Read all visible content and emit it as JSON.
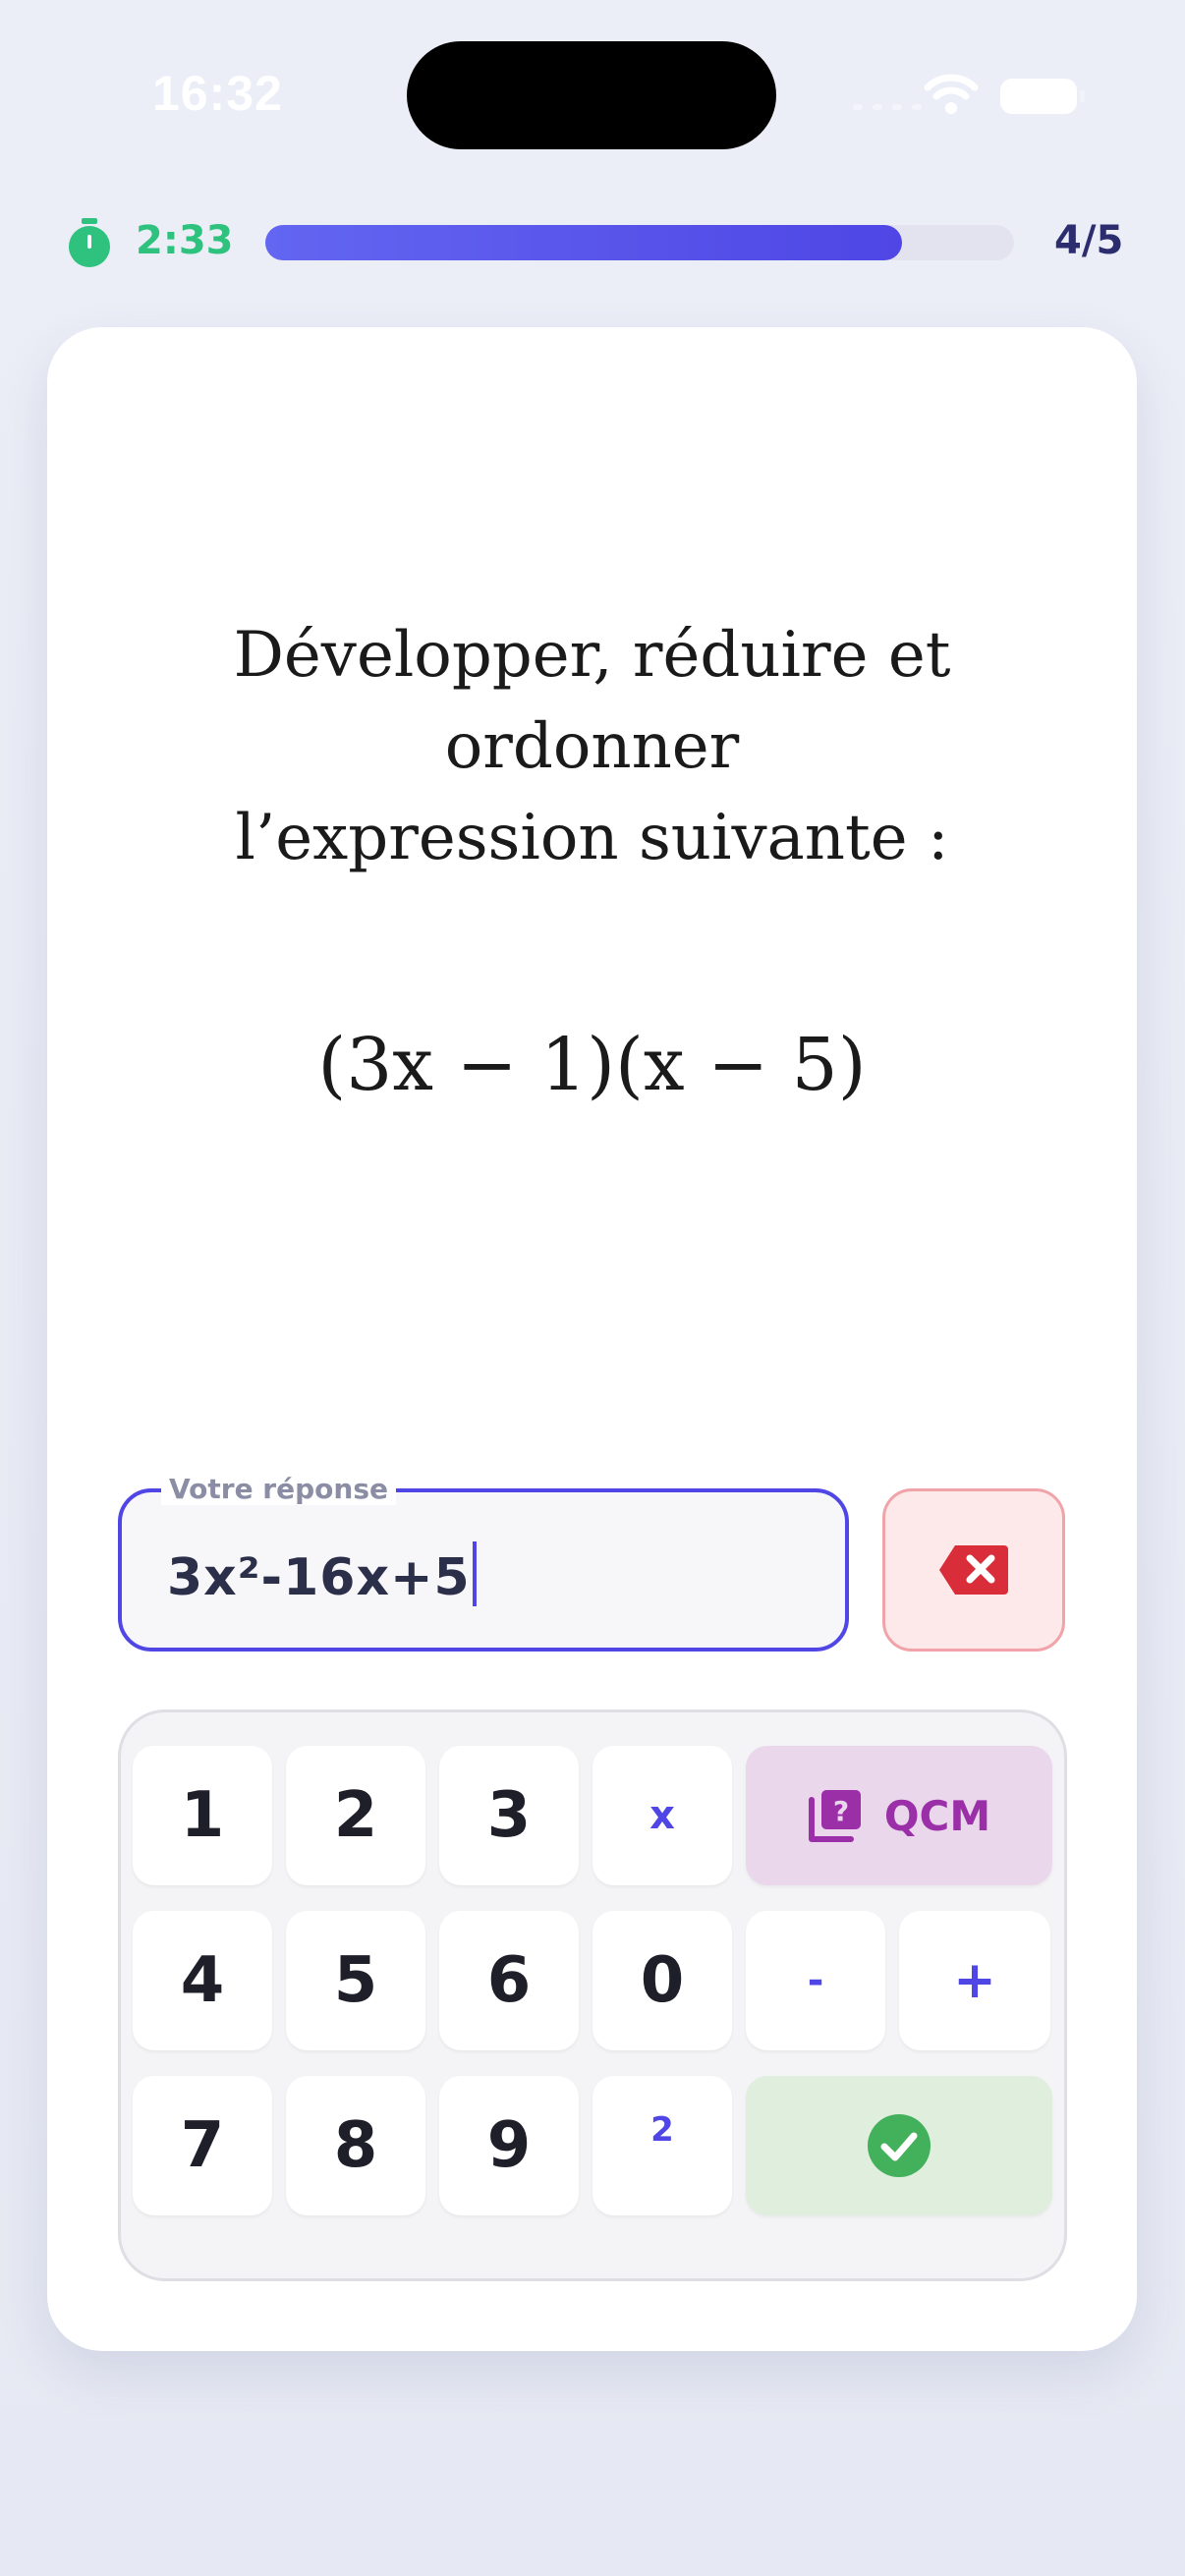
{
  "status_bar": {
    "time": "16:32"
  },
  "header": {
    "timer": "2:33",
    "progress_fraction": 0.85,
    "counter": "4/5"
  },
  "question": {
    "lines": [
      "Développer, réduire et",
      "ordonner",
      "l’expression suivante :"
    ],
    "expression": "(3x − 1)(x − 5)"
  },
  "answer": {
    "label": "Votre réponse",
    "value": "3x²-16x+5"
  },
  "keypad": {
    "row1": [
      "1",
      "2",
      "3",
      "x"
    ],
    "qcm_label": "QCM",
    "row2": [
      "4",
      "5",
      "6",
      "0",
      "-",
      "+"
    ],
    "row3": [
      "7",
      "8",
      "9",
      "2"
    ]
  },
  "colors": {
    "accent": "#4f46e5",
    "timer_green": "#2ec27e",
    "delete_red": "#d92d3a",
    "qcm_purple": "#9a2fa8",
    "validate_green": "#43b05c"
  },
  "icons": [
    "stopwatch-icon",
    "backspace-icon",
    "question-stack-icon",
    "check-circle-icon",
    "wifi-icon",
    "battery-icon"
  ]
}
